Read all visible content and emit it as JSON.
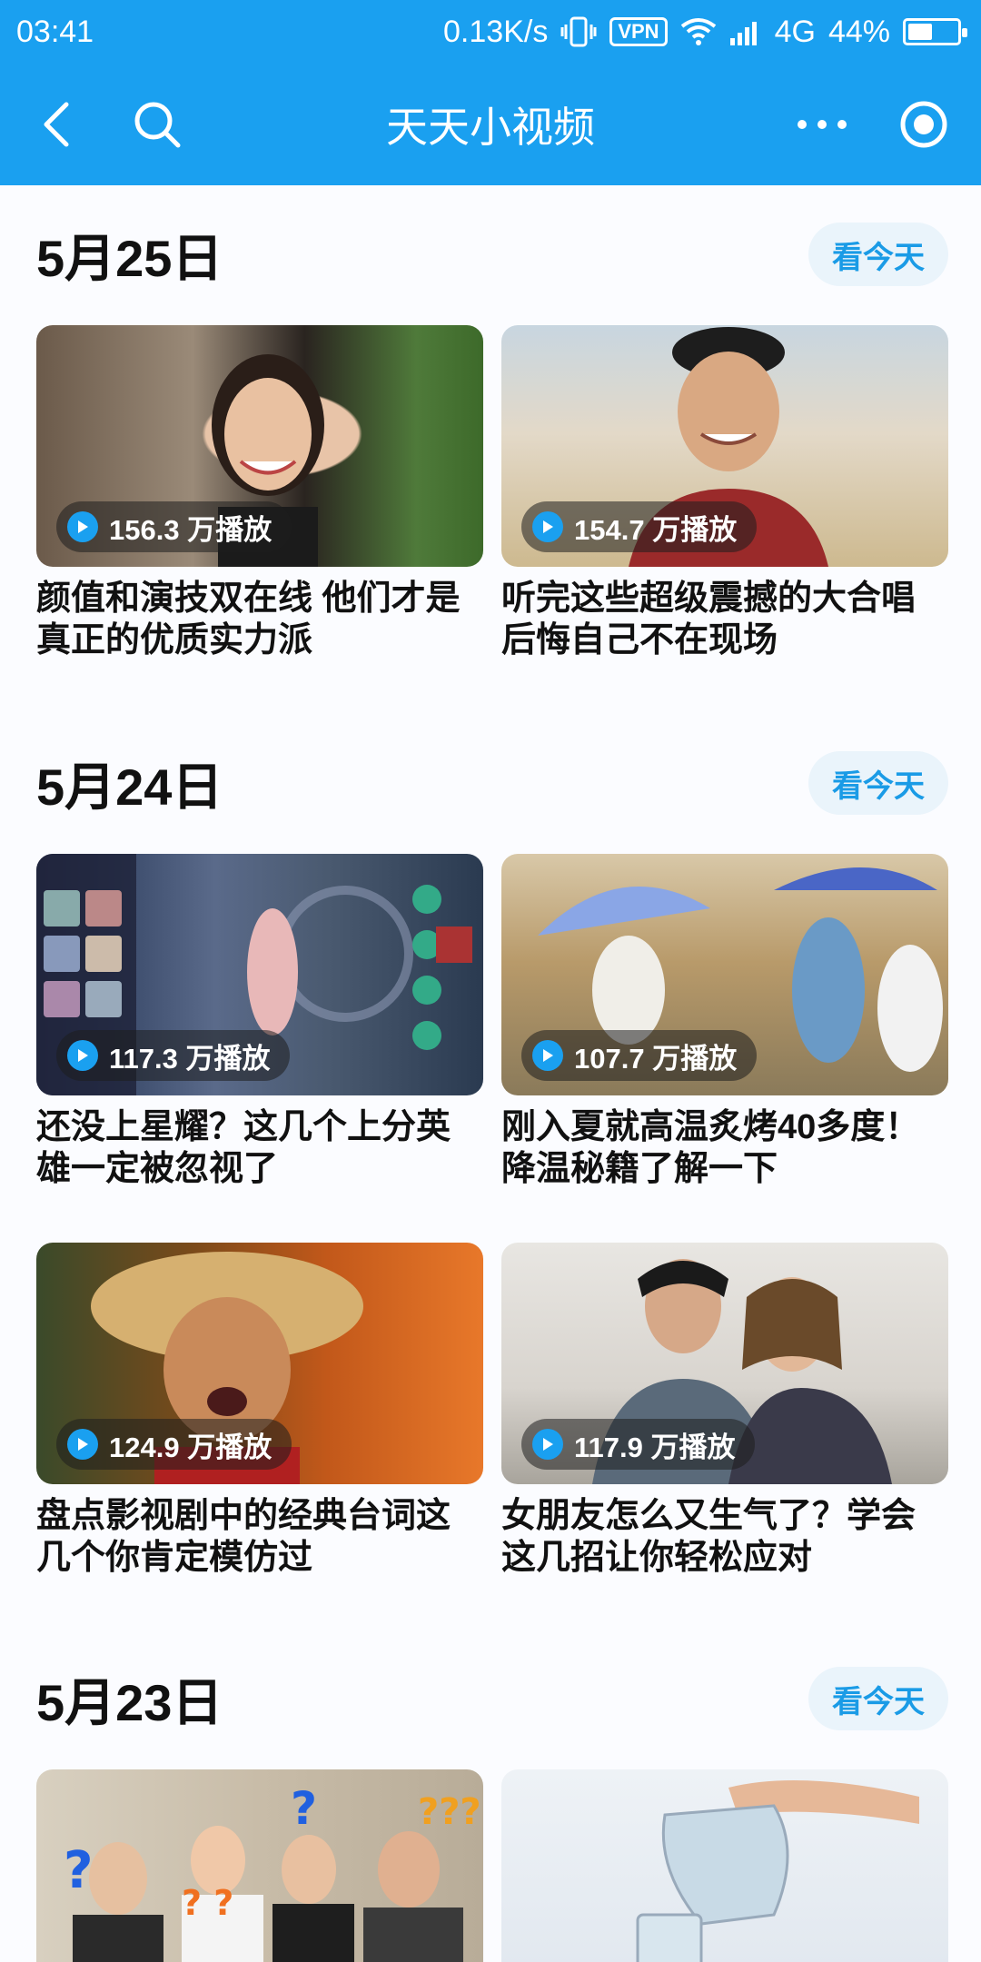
{
  "status_bar": {
    "time": "03:41",
    "speed": "0.13K/s",
    "vpn": "VPN",
    "network": "4G",
    "battery": "44%"
  },
  "app_bar": {
    "title": "天天小视频",
    "back_icon": "back-arrow-icon",
    "search_icon": "search-icon",
    "more_icon": "more-dots-icon",
    "target_icon": "record-target-icon"
  },
  "today_label": "看今天",
  "sections": [
    {
      "date": "5月25日",
      "videos": [
        {
          "plays": "156.3 万播放",
          "title": "颜值和演技双在线 他们才是真正的优质实力派"
        },
        {
          "plays": "154.7 万播放",
          "title": "听完这些超级震撼的大合唱后悔自己不在现场"
        }
      ]
    },
    {
      "date": "5月24日",
      "videos": [
        {
          "plays": "117.3 万播放",
          "title": "还没上星耀？这几个上分英雄一定被忽视了"
        },
        {
          "plays": "107.7 万播放",
          "title": "刚入夏就高温炙烤40多度！降温秘籍了解一下"
        },
        {
          "plays": "124.9 万播放",
          "title": "盘点影视剧中的经典台词这几个你肯定模仿过"
        },
        {
          "plays": "117.9 万播放",
          "title": "女朋友怎么又生气了？学会这几招让你轻松应对"
        }
      ]
    },
    {
      "date": "5月23日",
      "videos": [
        {
          "plays": "",
          "title": ""
        },
        {
          "plays": "",
          "title": ""
        }
      ]
    }
  ],
  "colors": {
    "brand": "#1aa0f0",
    "today_button_bg": "#eaf4fb",
    "today_button_text": "#1a9be6"
  }
}
